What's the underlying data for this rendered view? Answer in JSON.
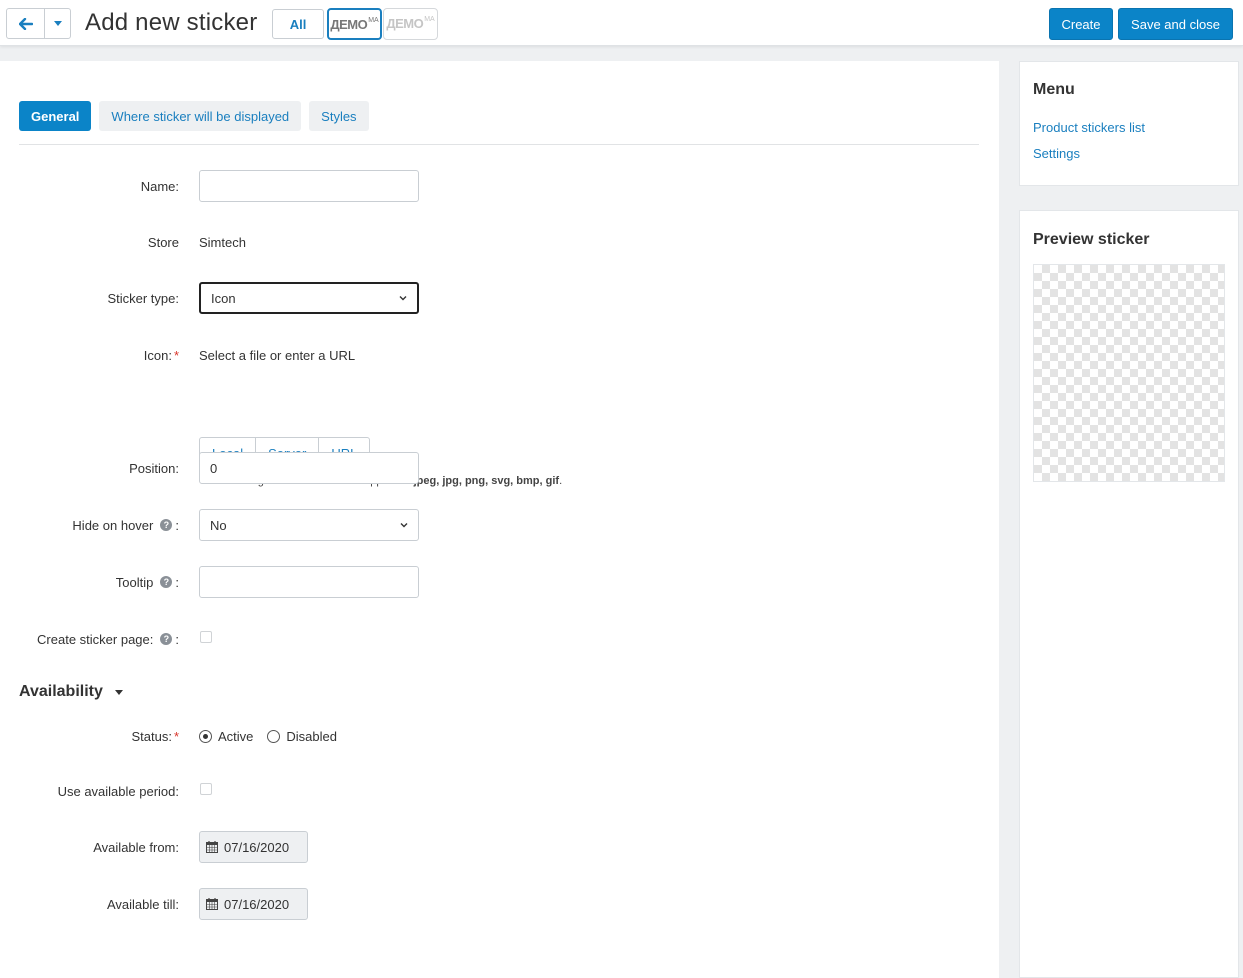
{
  "header": {
    "title": "Add new sticker",
    "store_all": "All",
    "store_logo_text": "ДЕМО",
    "store_logo_sup": "МА",
    "create_label": "Create",
    "save_close_label": "Save and close"
  },
  "tabs": [
    {
      "label": "General",
      "active": true
    },
    {
      "label": "Where sticker will be displayed",
      "active": false
    },
    {
      "label": "Styles",
      "active": false
    }
  ],
  "form": {
    "name": {
      "label": "Name:",
      "value": ""
    },
    "store": {
      "label": "Store",
      "value": "Simtech"
    },
    "sticker_type": {
      "label": "Sticker type:",
      "value": "Icon"
    },
    "icon": {
      "label": "Icon:",
      "required_mark": "*",
      "prompt": "Select a file or enter a URL",
      "sources": [
        "Local",
        "Server",
        "URL"
      ],
      "hint_prefix": "The following file extensions are supported: ",
      "hint_exts": "jpeg, jpg, png, svg, bmp, gif",
      "hint_suffix": "."
    },
    "position": {
      "label": "Position:",
      "value": "0"
    },
    "hide_on_hover": {
      "label": "Hide on hover",
      "value": "No"
    },
    "tooltip": {
      "label": "Tooltip",
      "value": ""
    },
    "create_sticker_page": {
      "label": "Create sticker page:",
      "checked": false
    },
    "colon": ":"
  },
  "availability": {
    "title": "Availability",
    "status": {
      "label": "Status:",
      "required_mark": "*",
      "options": [
        "Active",
        "Disabled"
      ],
      "selected": "Active"
    },
    "use_period": {
      "label": "Use available period:",
      "checked": false
    },
    "from": {
      "label": "Available from:",
      "value": "07/16/2020"
    },
    "till": {
      "label": "Available till:",
      "value": "07/16/2020"
    }
  },
  "sidebar": {
    "menu_title": "Menu",
    "links": [
      "Product stickers list",
      "Settings"
    ],
    "preview_title": "Preview sticker"
  },
  "colors": {
    "accent": "#0b84c8",
    "link": "#1a7fbf",
    "required": "#d9352b"
  },
  "icons": {
    "back": "arrow-left-icon",
    "dropdown": "caret-down-icon",
    "help": "question-circle-icon",
    "calendar": "calendar-icon"
  }
}
